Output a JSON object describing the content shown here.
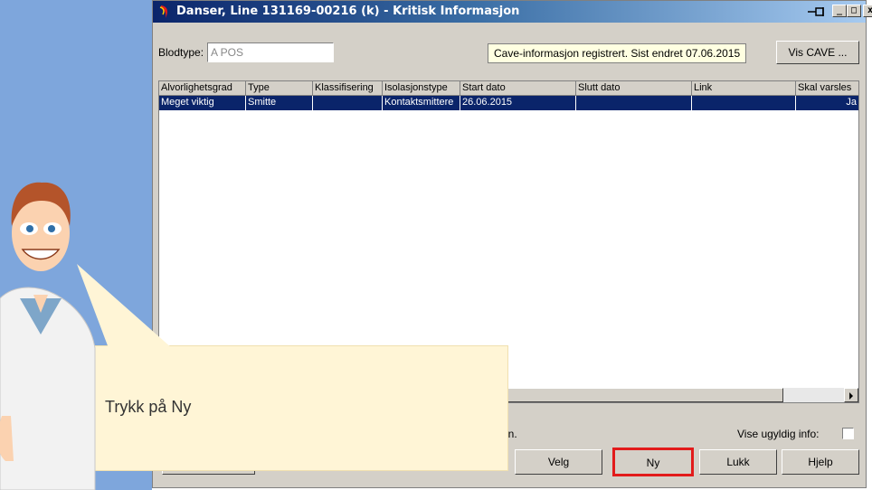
{
  "window": {
    "title": "Danser, Line  131169-00216 (k) - Kritisk Informasjon"
  },
  "controls": {
    "minimize": "_",
    "maximize": "□",
    "close": "x"
  },
  "bloodtype": {
    "label": "Blodtype:",
    "value": "A POS"
  },
  "cave_info": {
    "text": "Cave-informasjon registrert. Sist endret 07.06.2015"
  },
  "buttons": {
    "vis_cave": "Vis CAVE ...",
    "velg": "Velg",
    "ny": "Ny",
    "lukk": "Lukk",
    "hjelp": "Hjelp"
  },
  "table": {
    "headers": [
      "Alvorlighetsgrad",
      "Type",
      "Klassifisering",
      "Isolasjonstype",
      "Start dato",
      "Slutt dato",
      "Link",
      "Skal varsles"
    ],
    "rows": [
      [
        "Meget viktig",
        "Smitte",
        "",
        "Kontaktsmittere",
        "26.06.2015",
        "",
        "",
        "Ja"
      ]
    ]
  },
  "status": {
    "partial_text": "en.",
    "vise_label": "Vise ugyldig info:"
  },
  "callout": {
    "text": "Trykk på Ny"
  },
  "colors": {
    "highlight": "#e21b1b",
    "selection": "#0a246a",
    "callout_bg": "#fff5d6"
  }
}
